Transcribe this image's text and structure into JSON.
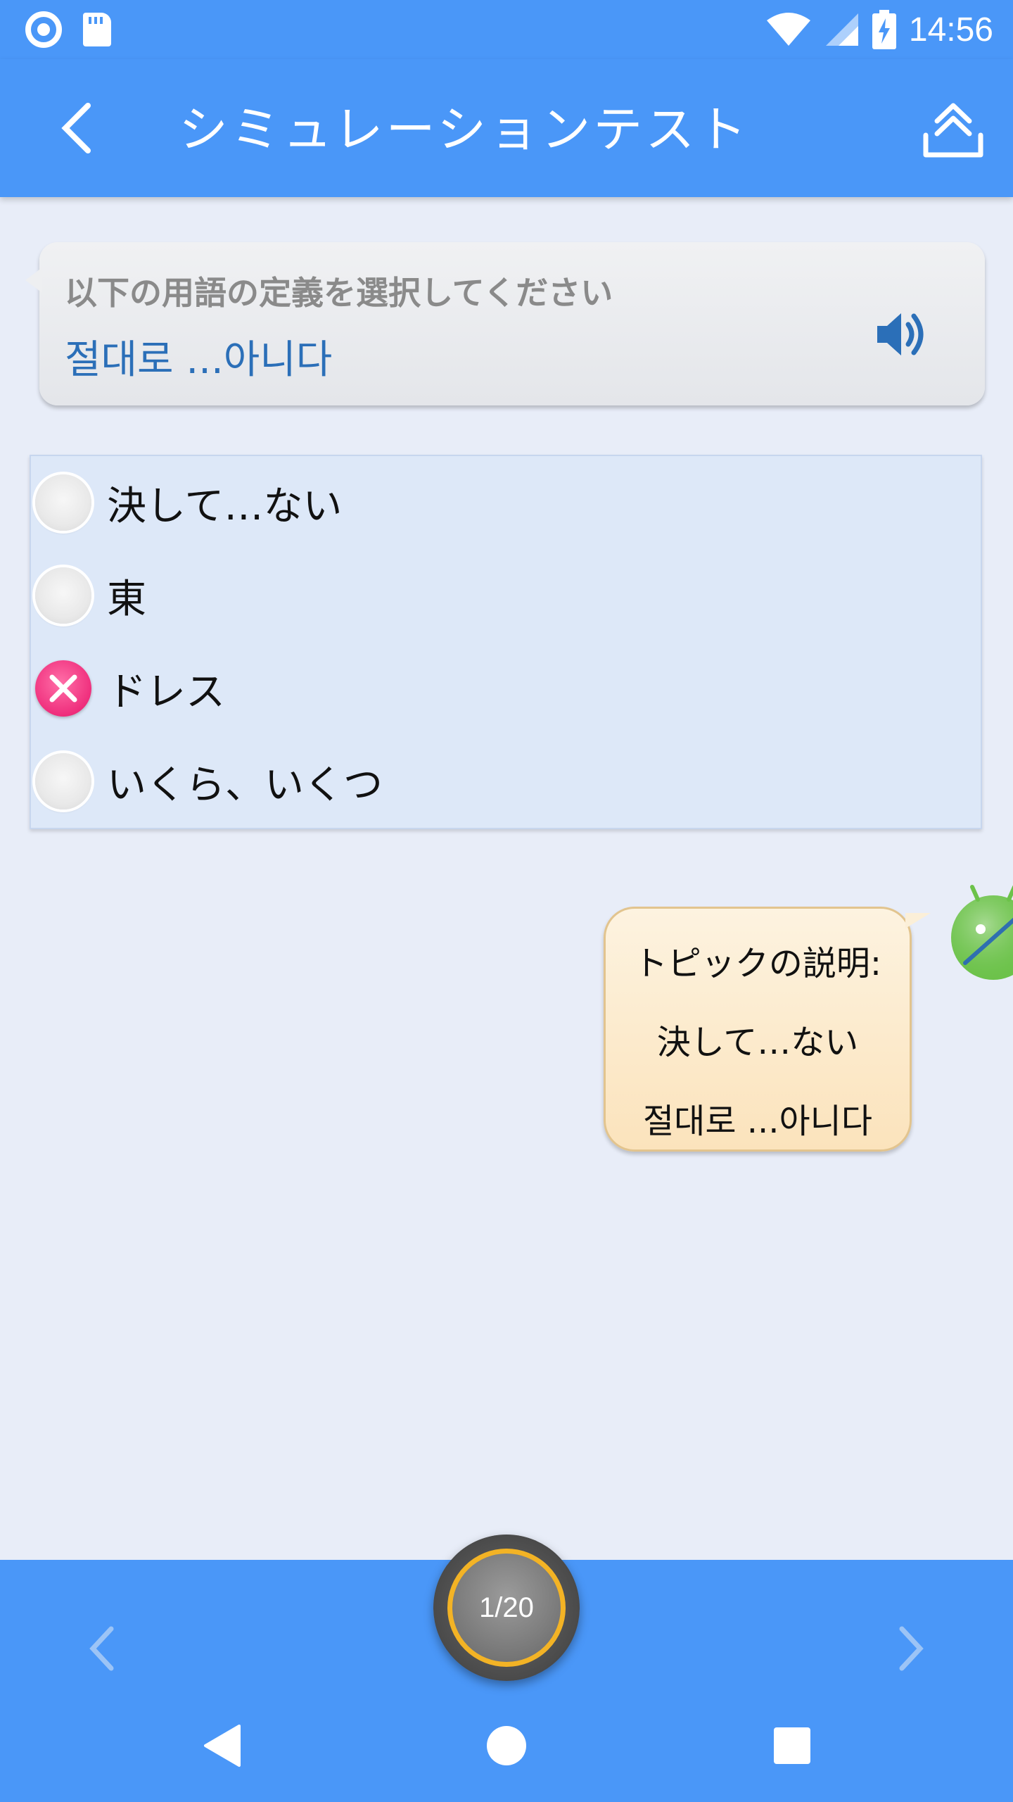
{
  "status_bar": {
    "time": "14:56"
  },
  "app_bar": {
    "title": "シミュレーションテスト"
  },
  "question": {
    "prompt": "以下の用語の定義を選択してください",
    "term": "절대로 ...아니다"
  },
  "options": [
    {
      "label": "決して…ない",
      "state": "unselected"
    },
    {
      "label": "東",
      "state": "unselected"
    },
    {
      "label": "ドレス",
      "state": "wrong"
    },
    {
      "label": "いくら、いくつ",
      "state": "unselected"
    }
  ],
  "explanation": {
    "heading": "トピックの説明:",
    "answer": "決して…ない",
    "term": "절대로 ...아니다"
  },
  "progress": {
    "label": "1/20"
  },
  "colors": {
    "primary": "#4a97f8",
    "background": "#e8edf8",
    "term_text": "#2b6fb8",
    "wrong": "#ef2e7c",
    "counter_ring": "#f3b325"
  }
}
